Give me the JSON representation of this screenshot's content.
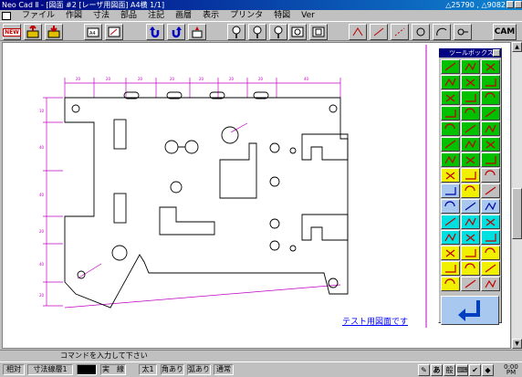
{
  "window": {
    "title": "Neo Cad Ⅱ - [図面 #2 [レーザ用図面] A4横 1/1]",
    "coords": "△25790 , △9082"
  },
  "menu": [
    "ファイル",
    "作図",
    "寸法",
    "部品",
    "注記",
    "画層",
    "表示",
    "プリンタ",
    "特図",
    "Ver"
  ],
  "toolbar": {
    "new_label": "NEW",
    "cam_label": "CAM"
  },
  "toolbox": {
    "title": "ツールボックス"
  },
  "canvas": {
    "sample_label": "テスト用図面です"
  },
  "command": {
    "prompt": "コマンドを入力して下さい"
  },
  "status": {
    "relative": "相対",
    "layer": "寸法線層1",
    "line_type": "実　線",
    "width": "太1",
    "corner": "角あり",
    "arc": "弧あり",
    "step": "通常"
  },
  "tray": {
    "ime_1": "あ",
    "ime_2": "般",
    "clock_top": "0:00",
    "clock_bottom": "PM"
  },
  "colors": {
    "title_bar": "#000080",
    "dimension_lines": "#c000c0",
    "drawing_lines": "#000000",
    "sample_label": "#0000ff",
    "palette_green": "#00c000",
    "palette_cyan": "#00e0e0",
    "palette_yellow": "#f0f000"
  }
}
